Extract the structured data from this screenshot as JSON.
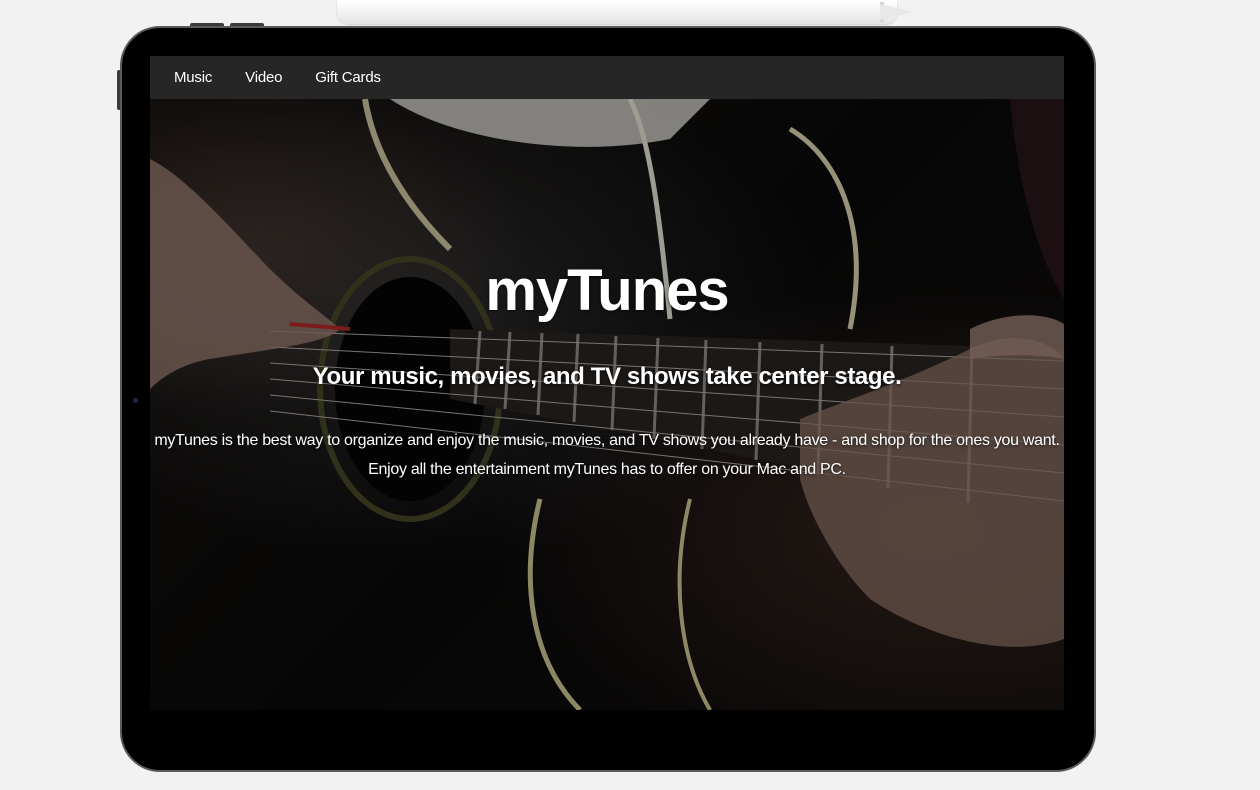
{
  "nav": {
    "items": [
      {
        "label": "Music"
      },
      {
        "label": "Video"
      },
      {
        "label": "Gift Cards"
      }
    ]
  },
  "hero": {
    "title": "myTunes",
    "subtitle": "Your music, movies, and TV shows take center stage.",
    "description_line1": "myTunes is the best way to organize and enjoy the music, movies, and TV shows you already have - and shop for the ones you want.",
    "description_line2": "Enjoy all the entertainment myTunes has to offer on your Mac and PC.",
    "background_image": "guitar-player"
  },
  "colors": {
    "page_background": "#f2f2f2",
    "navbar_background": "#262626",
    "text": "#ffffff",
    "device_frame": "#000000"
  }
}
